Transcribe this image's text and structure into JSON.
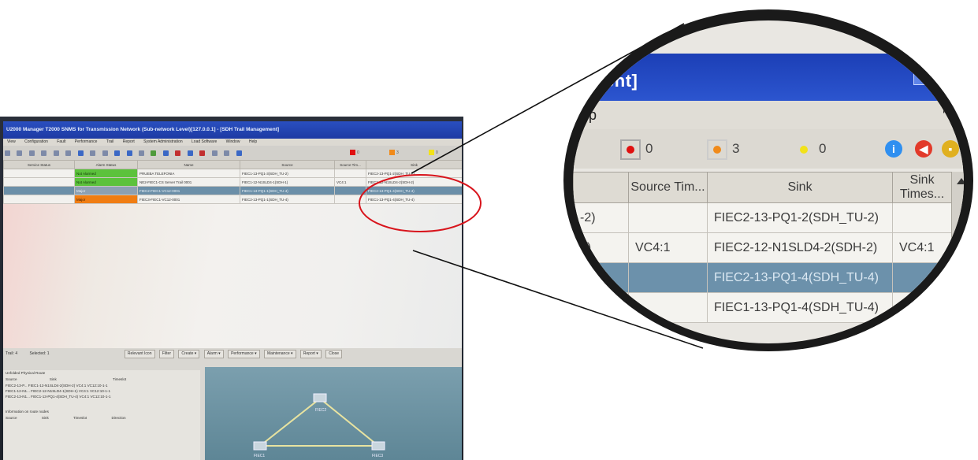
{
  "window": {
    "title": "U2000 Manager T2000 SNMS for Transmission Network (Sub-network Level)[127.0.0.1] - [SDH Trail Management]",
    "zoom_title": "ment]"
  },
  "menu": {
    "items": [
      "View",
      "Configuration",
      "Fault",
      "Performance",
      "Trail",
      "Report",
      "System Administration",
      "Load Software",
      "Window",
      "Help"
    ],
    "zoom_item": "lp"
  },
  "alarms": {
    "critical": "0",
    "major": "3",
    "minor": "0",
    "colors": {
      "critical": "#e01010",
      "major": "#f08a1a",
      "minor": "#f2e21a"
    }
  },
  "table": {
    "columns": [
      "Service Status",
      "Alarm Status",
      "Name",
      "Source",
      "Source Tim...",
      "Sink"
    ],
    "rows": [
      {
        "service": "",
        "alarm": "Not Alarmed",
        "alarm_class": "green",
        "name": "PRUEBA TELEFONIA",
        "source": "FIEC1-13-PQ1-3(SDH_TU-2)",
        "source_ts": "",
        "sink": "FIEC2-13-PQ1-2(SDH_TU-2)",
        "selected": false
      },
      {
        "service": "",
        "alarm": "Not Alarmed",
        "alarm_class": "green",
        "name": "NE2-FIEC1-CS Server Trail 0001",
        "source": "FIEC1-12-N1SLD4-1(SDH-1)",
        "source_ts": "VC4:1",
        "sink": "FIEC2-12-N1SLD4-2(SDH-2)",
        "selected": false
      },
      {
        "service": "",
        "alarm": "Major",
        "alarm_class": "gray",
        "name": "FIEC2-FIEC1-VC12-0001",
        "source": "FIEC1-13-PQ1-1(SDH_TU-4)",
        "sink": "FIEC2-13-PQ1-4(SDH_TU-4)",
        "source_ts": "",
        "selected": true
      },
      {
        "service": "",
        "alarm": "Major",
        "alarm_class": "orange",
        "name": "FIEC3-FIEC1-VC12-0001",
        "source": "FIEC2-13-PQ1-1(SDH_TU-4)",
        "sink": "FIEC1-13-PQ1-4(SDH_TU-4)",
        "source_ts": "",
        "selected": false
      }
    ]
  },
  "zoom_table": {
    "columns": [
      "",
      "Source Tim...",
      "Sink",
      "Sink Times..."
    ],
    "rows": [
      {
        "left": "-2)",
        "source_ts": "",
        "sink": "FIEC2-13-PQ1-2(SDH_TU-2)",
        "sink_ts": "",
        "selected": false
      },
      {
        "left": "1)",
        "source_ts": "VC4:1",
        "sink": "FIEC2-12-N1SLD4-2(SDH-2)",
        "sink_ts": "VC4:1",
        "selected": false
      },
      {
        "left": ")",
        "source_ts": "",
        "sink": "FIEC2-13-PQ1-4(SDH_TU-4)",
        "sink_ts": "",
        "selected": true
      },
      {
        "left": "",
        "source_ts": "",
        "sink": "FIEC1-13-PQ1-4(SDH_TU-4)",
        "sink_ts": "",
        "selected": false
      }
    ]
  },
  "lower": {
    "tabs": [
      "Trail: 4",
      "Selected: 1"
    ],
    "buttons": [
      "Relevant Icon",
      "Filter",
      "Create ▾",
      "Alarm ▾",
      "Performance ▾",
      "Maintenance ▾",
      "Report ▾",
      "Close"
    ],
    "routes_title": "Unfolded Physical Route",
    "routes_header": [
      "Source",
      "Sink",
      "Timeslot"
    ],
    "routes": [
      "FIEC2-13-P... FIEC1-12-N1SLD4-2(SDH-2) VC4:1 VC12:10-1-1",
      "FIEC1-12-N1... FIEC2-12-N1SLD4-1(SDH-1) VC4:1 VC12:10-1-1",
      "FIEC2-13-N1... FIEC1-13-PQ1-4(SDH_TU-4) VC4:1 VC12:10-1-1"
    ],
    "info_title": "Information on route nodes",
    "info_header": [
      "Source",
      "Sink",
      "Timeslot",
      "Direction"
    ],
    "topo_nodes": [
      "FIEC2",
      "FIEC1",
      "FIEC3"
    ]
  }
}
